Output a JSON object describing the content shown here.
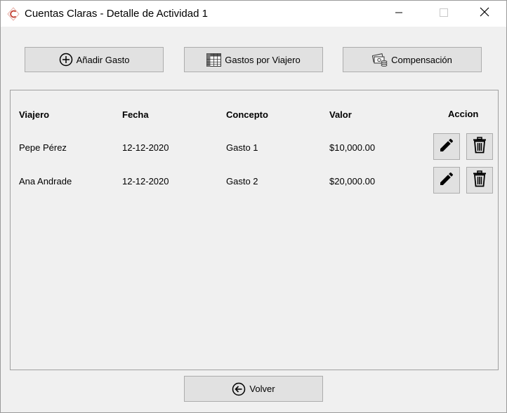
{
  "window": {
    "title": "Cuentas Claras - Detalle de Actividad 1"
  },
  "toolbar": {
    "add_expense_label": "Añadir Gasto",
    "expenses_by_traveler_label": "Gastos por Viajero",
    "compensation_label": "Compensación"
  },
  "table": {
    "headers": {
      "traveler": "Viajero",
      "date": "Fecha",
      "concept": "Concepto",
      "value": "Valor",
      "action": "Accion"
    },
    "rows": [
      {
        "traveler": "Pepe Pérez",
        "date": "12-12-2020",
        "concept": "Gasto 1",
        "value": "$10,000.00"
      },
      {
        "traveler": "Ana Andrade",
        "date": "12-12-2020",
        "concept": "Gasto 2",
        "value": "$20,000.00"
      }
    ]
  },
  "footer": {
    "back_label": "Volver"
  },
  "icons": {
    "app": "cuentas-claras-logo",
    "add": "plus-circle-icon",
    "table": "spreadsheet-icon",
    "money": "money-coins-icon",
    "edit": "pencil-icon",
    "delete": "trash-icon",
    "back": "arrow-left-circle-icon"
  },
  "colors": {
    "logo": "#c0392b",
    "window_bg": "#f0f0f0",
    "button_bg": "#e1e1e1"
  }
}
